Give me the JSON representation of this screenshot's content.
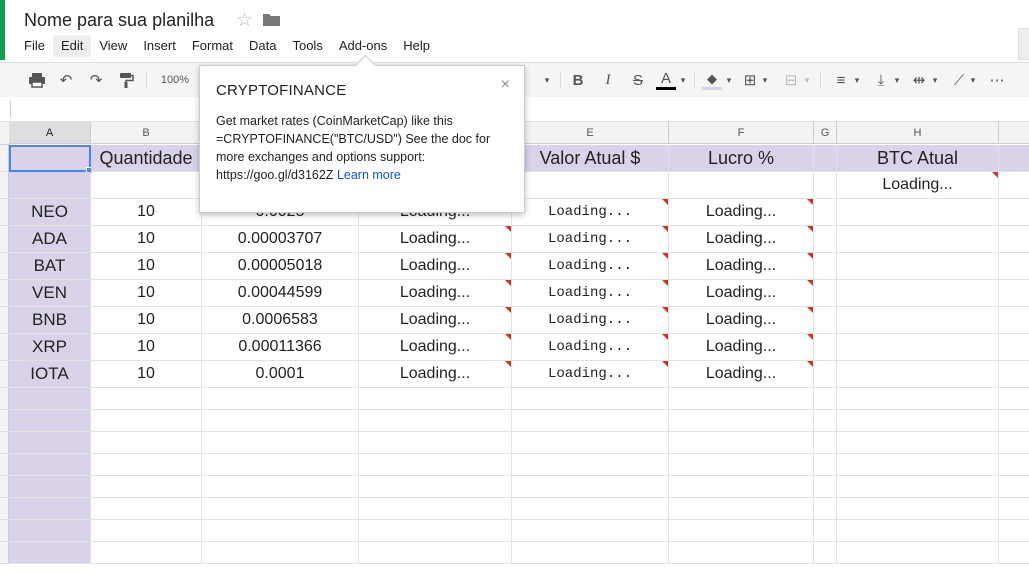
{
  "doc": {
    "title": "Nome para sua planilha"
  },
  "menu": [
    "File",
    "Edit",
    "View",
    "Insert",
    "Format",
    "Data",
    "Tools",
    "Add-ons",
    "Help"
  ],
  "toolbar": {
    "zoom": "100%"
  },
  "columns": [
    "A",
    "B",
    "",
    "",
    "E",
    "F",
    "G",
    "H"
  ],
  "headers": {
    "b": "Quantidade",
    "e": "Valor Atual $",
    "f": "Lucro %",
    "h": "BTC Atual"
  },
  "btc_cell": "Loading...",
  "rows": [
    {
      "coin": "NEO",
      "qty": "10",
      "price": "0.0025",
      "d": "Loading...",
      "e": "Loading...",
      "f": "Loading..."
    },
    {
      "coin": "ADA",
      "qty": "10",
      "price": "0.00003707",
      "d": "Loading...",
      "e": "Loading...",
      "f": "Loading..."
    },
    {
      "coin": "BAT",
      "qty": "10",
      "price": "0.00005018",
      "d": "Loading...",
      "e": "Loading...",
      "f": "Loading..."
    },
    {
      "coin": "VEN",
      "qty": "10",
      "price": "0.00044599",
      "d": "Loading...",
      "e": "Loading...",
      "f": "Loading..."
    },
    {
      "coin": "BNB",
      "qty": "10",
      "price": "0.0006583",
      "d": "Loading...",
      "e": "Loading...",
      "f": "Loading..."
    },
    {
      "coin": "XRP",
      "qty": "10",
      "price": "0.00011366",
      "d": "Loading...",
      "e": "Loading...",
      "f": "Loading..."
    },
    {
      "coin": "IOTA",
      "qty": "10",
      "price": "0.0001",
      "d": "Loading...",
      "e": "Loading...",
      "f": "Loading..."
    }
  ],
  "popup": {
    "title": "CRYPTOFINANCE",
    "description": "Get market rates (CoinMarketCap) like this =CRYPTOFINANCE(\"BTC/USD\") See the doc for more exchanges and options support: https://goo.gl/d3162Z",
    "link": "Learn more",
    "close": "×"
  },
  "colors": {
    "header_fill": "#d9d2e9",
    "error_flag": "#c0392b",
    "link": "#1155cc",
    "selection": "#4285f4"
  }
}
